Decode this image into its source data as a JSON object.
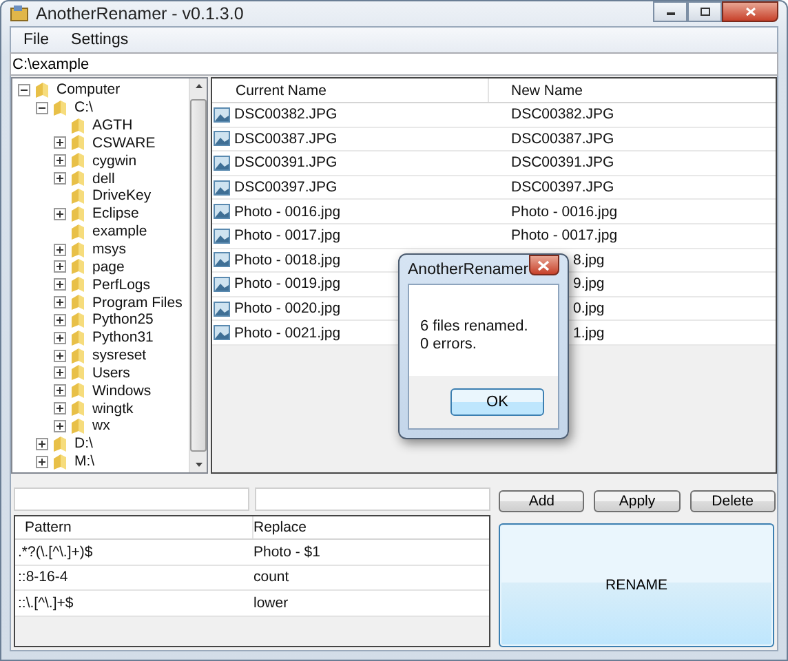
{
  "window": {
    "title": "AnotherRenamer - v0.1.3.0"
  },
  "menu": [
    "File",
    "Settings"
  ],
  "path_field": {
    "value": "C:\\example"
  },
  "tree": [
    {
      "label": "Computer",
      "has_children": true,
      "expanded": true,
      "children": [
        {
          "label": "C:\\",
          "has_children": true,
          "expanded": true,
          "children": [
            {
              "label": "AGTH",
              "has_children": false
            },
            {
              "label": "CSWARE",
              "has_children": true,
              "expanded": false
            },
            {
              "label": "cygwin",
              "has_children": true,
              "expanded": false
            },
            {
              "label": "dell",
              "has_children": true,
              "expanded": false
            },
            {
              "label": "DriveKey",
              "has_children": false
            },
            {
              "label": "Eclipse",
              "has_children": true,
              "expanded": false
            },
            {
              "label": "example",
              "has_children": false
            },
            {
              "label": "msys",
              "has_children": true,
              "expanded": false
            },
            {
              "label": "page",
              "has_children": true,
              "expanded": false
            },
            {
              "label": "PerfLogs",
              "has_children": true,
              "expanded": false
            },
            {
              "label": "Program Files",
              "has_children": true,
              "expanded": false
            },
            {
              "label": "Python25",
              "has_children": true,
              "expanded": false
            },
            {
              "label": "Python31",
              "has_children": true,
              "expanded": false
            },
            {
              "label": "sysreset",
              "has_children": true,
              "expanded": false
            },
            {
              "label": "Users",
              "has_children": true,
              "expanded": false
            },
            {
              "label": "Windows",
              "has_children": true,
              "expanded": false
            },
            {
              "label": "wingtk",
              "has_children": true,
              "expanded": false
            },
            {
              "label": "wx",
              "has_children": true,
              "expanded": false
            }
          ]
        },
        {
          "label": "D:\\",
          "has_children": true,
          "expanded": false
        },
        {
          "label": "M:\\",
          "has_children": true,
          "expanded": false
        }
      ]
    }
  ],
  "file_list": {
    "columns": [
      "Current Name",
      "New Name"
    ],
    "rows": [
      {
        "current": "DSC00382.JPG",
        "new": "DSC00382.JPG",
        "new_covered": false
      },
      {
        "current": "DSC00387.JPG",
        "new": "DSC00387.JPG",
        "new_covered": false
      },
      {
        "current": "DSC00391.JPG",
        "new": "DSC00391.JPG",
        "new_covered": false
      },
      {
        "current": "DSC00397.JPG",
        "new": "DSC00397.JPG",
        "new_covered": false
      },
      {
        "current": "Photo - 0016.jpg",
        "new": "Photo - 0016.jpg",
        "new_covered": false
      },
      {
        "current": "Photo - 0017.jpg",
        "new": "Photo - 0017.jpg",
        "new_covered": false
      },
      {
        "current": "Photo - 0018.jpg",
        "new": "8.jpg",
        "new_covered": true
      },
      {
        "current": "Photo - 0019.jpg",
        "new": "9.jpg",
        "new_covered": true
      },
      {
        "current": "Photo - 0020.jpg",
        "new": "0.jpg",
        "new_covered": true
      },
      {
        "current": "Photo - 0021.jpg",
        "new": "1.jpg",
        "new_covered": true
      }
    ]
  },
  "buttons": [
    "Add",
    "Apply",
    "Delete"
  ],
  "rules": {
    "columns": [
      "Pattern",
      "Replace"
    ],
    "rows": [
      {
        "pattern": ".*?(\\.[^\\.]+)$",
        "replace": "Photo - $1"
      },
      {
        "pattern": "::8-16-4",
        "replace": "count"
      },
      {
        "pattern": "::\\.[^\\.]+$",
        "replace": "lower"
      }
    ]
  },
  "rename_button": "RENAME",
  "dialog": {
    "title": "AnotherRenamer",
    "lines": [
      "6 files renamed.",
      "0 errors."
    ],
    "button": "OK"
  }
}
